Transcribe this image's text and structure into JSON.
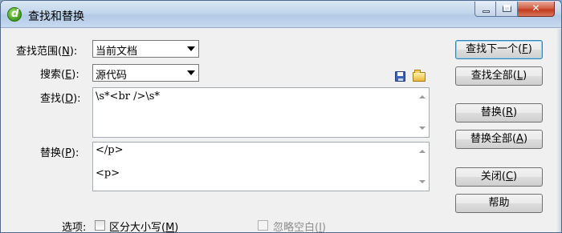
{
  "window": {
    "title": "查找和替换"
  },
  "labels": {
    "scope": "查找范围(",
    "scope_key": "N",
    "scope_end": "):",
    "search": "搜索(",
    "search_key": "E",
    "search_end": "):",
    "find": "查找(",
    "find_key": "D",
    "find_end": "):",
    "replace": "替换(",
    "replace_key": "P",
    "replace_end": "):",
    "options": "选项:"
  },
  "fields": {
    "scope_value": "当前文档",
    "search_value": "源代码",
    "find_text": "\\s*<br />\\s*",
    "replace_line1": "</p>",
    "replace_line2": "<p>"
  },
  "buttons": {
    "find_next": "查找下一个(",
    "find_next_key": "F",
    "find_all": "查找全部(",
    "find_all_key": "L",
    "replace": "替换(",
    "replace_key": "R",
    "replace_all": "替换全部(",
    "replace_all_key": "A",
    "close": "关闭(",
    "close_key": "C",
    "help": "帮助",
    "close_paren": ")"
  },
  "options": {
    "match_case": "区分大小写(",
    "match_case_key": "M",
    "ignore_whitespace": "忽略空白(",
    "ignore_whitespace_key": "I",
    "close_paren": ")"
  },
  "icons": {
    "app": "dreamweaver-app-icon",
    "save": "save-query-icon",
    "load": "load-query-icon"
  }
}
